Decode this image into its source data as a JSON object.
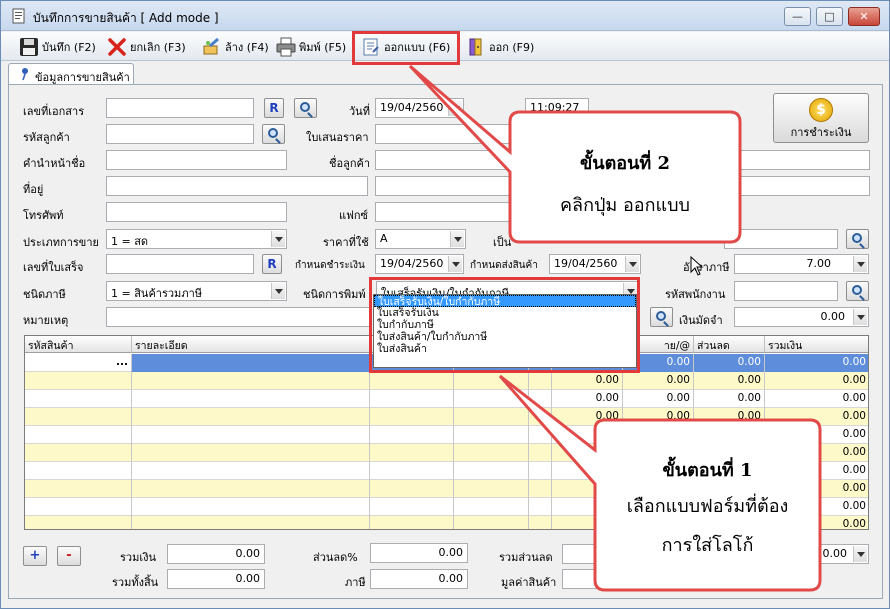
{
  "window": {
    "title": "บันทึกการขายสินค้า [ Add mode ]",
    "min_label": "—",
    "max_label": "□",
    "close_label": "✕"
  },
  "toolbar": {
    "save": "บันทึก (F2)",
    "cancel": "ยกเลิก (F3)",
    "clear": "ล้าง (F4)",
    "print": "พิมพ์ (F5)",
    "design": "ออกแบบ (F6)",
    "exit": "ออก (F9)"
  },
  "tab": {
    "label": "ข้อมูลการขายสินค้า"
  },
  "form": {
    "doc_no_label": "เลขที่เอกสาร",
    "doc_no_value": "",
    "r_label": "R",
    "date_label": "วันที่",
    "date_value": "19/04/2560",
    "time_value": "11:09:27",
    "customer_code_label": "รหัสลูกค้า",
    "quote_label": "ใบเสนอราคา",
    "title_label": "คำนำหน้าชื่อ",
    "customer_name_label": "ชื่อลูกค้า",
    "address_label": "ที่อยู่",
    "phone_label": "โทรศัพท์",
    "fax_label": "แฟกซ์",
    "sale_type_label": "ประเภทการขาย",
    "sale_type_value": "1 = สด",
    "price_used_label": "ราคาที่ใช้",
    "price_used_value": "A",
    "is_label": "เป็น",
    "invoice_no_label": "เลขที่ใบเสร็จ",
    "pay_due_label": "กำหนดชำระเงิน",
    "pay_due_value": "19/04/2560",
    "ship_due_label": "กำหนดส่งสินค้า",
    "ship_due_value": "19/04/2560",
    "tax_rate_label": "อัตราภาษี",
    "tax_rate_value": "7.00",
    "tax_type_label": "ชนิดภาษี",
    "tax_type_value": "1 = สินค้ารวมภาษี",
    "print_type_label": "ชนิดการพิมพ์",
    "print_type_value": "ใบเสร็จรับเงิน/ใบกำกับภาษี",
    "employee_code_label": "รหัสพนักงาน",
    "note_label": "หมายเหตุ",
    "deposit_label": "เงินมัดจำ",
    "deposit_value": "0.00",
    "pay_button": "การชำระเงิน",
    "pay_icon": "$"
  },
  "dropdown_options": [
    "ใบเสร็จรับเงิน/ใบกำกับภาษี",
    "ใบเสร็จรับเงิน",
    "ใบกำกับภาษี",
    "ใบส่งสินค้า/ใบกำกับภาษี",
    "ใบส่งสินค้า"
  ],
  "grid": {
    "headers": [
      "รหัสสินค้า",
      "รายละเอียด",
      "",
      "",
      "",
      "าย/@",
      "ส่วนลด",
      "รวมเงิน"
    ],
    "rows": [
      [
        "...",
        "",
        "",
        "",
        "",
        "0.00",
        "0.00",
        "0.00"
      ],
      [
        "",
        "",
        "",
        "",
        "0.00",
        "0.00",
        "0.00",
        "0.00"
      ],
      [
        "",
        "",
        "",
        "",
        "0.00",
        "0.00",
        "0.00",
        "0.00"
      ],
      [
        "",
        "",
        "",
        "",
        "0.00",
        "0.00",
        "0.00",
        "0.00"
      ],
      [
        "",
        "",
        "",
        "",
        "",
        "",
        "0.00",
        "0.00"
      ],
      [
        "",
        "",
        "",
        "",
        "",
        "",
        "0.00",
        "0.00"
      ],
      [
        "",
        "",
        "",
        "",
        "",
        "",
        "0.00",
        "0.00"
      ],
      [
        "",
        "",
        "",
        "",
        "",
        "",
        "0.00",
        "0.00"
      ],
      [
        "",
        "",
        "",
        "",
        "",
        "",
        "0.00",
        "0.00"
      ],
      [
        "",
        "",
        "",
        "",
        "",
        "",
        "0.00",
        "0.00"
      ]
    ]
  },
  "totals": {
    "plus": "+",
    "minus": "-",
    "sum_label": "รวมเงิน",
    "sum_value": "0.00",
    "discount_pct_label": "ส่วนลด%",
    "discount_pct_value": "0.00",
    "total_discount_label": "รวมส่วนลด",
    "right_value": "0.00",
    "grand_total_label": "รวมทั้งสิ้น",
    "grand_total_value": "0.00",
    "tax_label": "ภาษี",
    "tax_value": "0.00",
    "goods_value_label": "มูลค่าสินค้า"
  },
  "callouts": {
    "step2_title": "ขั้นตอนที่ 2",
    "step2_text": "คลิกปุ่ม ออกแบบ",
    "step1_title": "ขั้นตอนที่ 1",
    "step1_line1": "เลือกแบบฟอร์มที่ต้อง",
    "step1_line2": "การใส่โลโก้"
  },
  "colors": {
    "highlight": "#e23a3a",
    "callout_fill": "#ffffff",
    "grid_row_alt": "#fdf9c9",
    "grid_selected": "#5e8edb"
  }
}
